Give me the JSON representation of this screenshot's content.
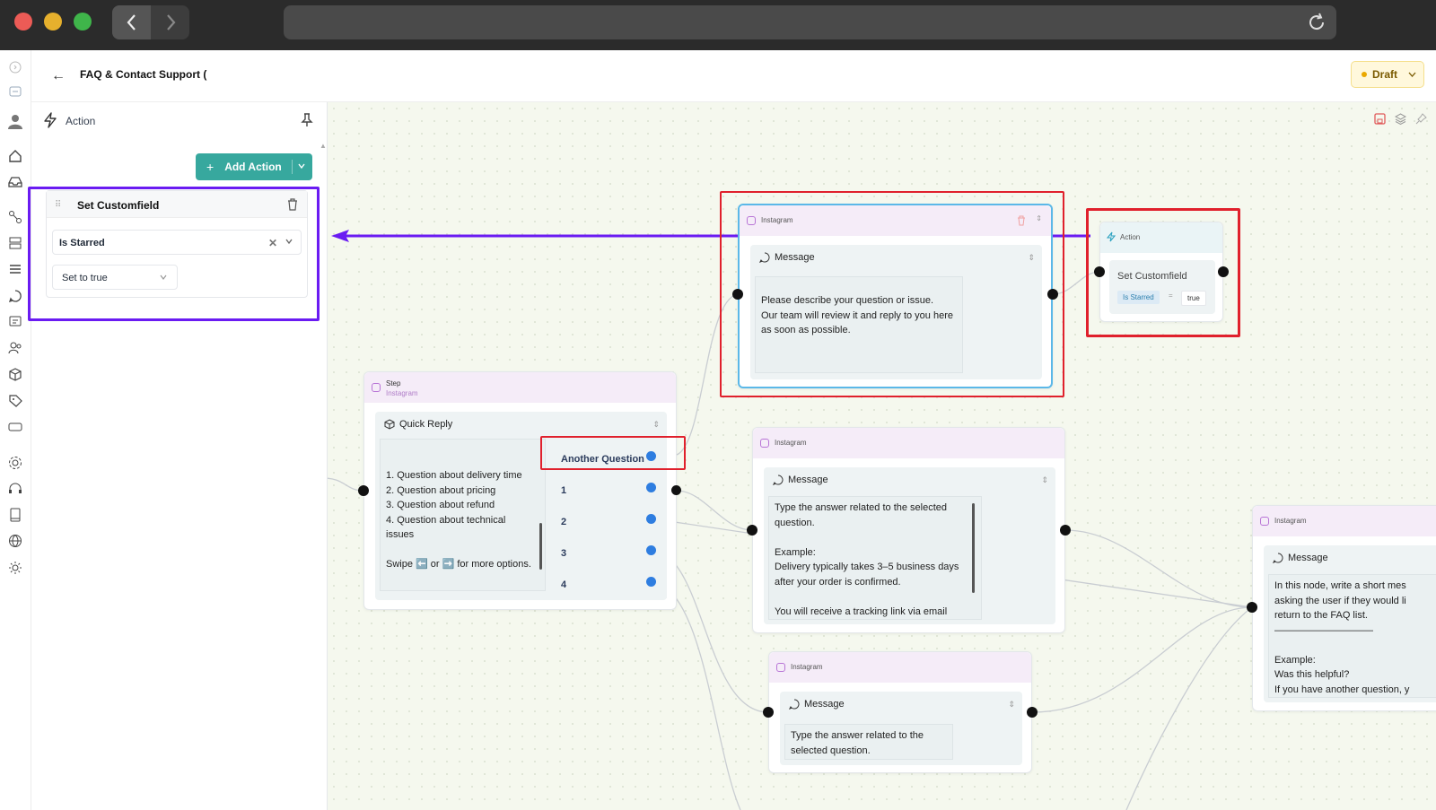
{
  "header": {
    "title": "FAQ & Contact Support (",
    "status": "Draft"
  },
  "sidebar": {
    "title": "Action",
    "add_action_label": "Add Action",
    "action_card": {
      "title": "Set Customfield",
      "field": "Is Starred",
      "value": "Set to true"
    }
  },
  "nodes": {
    "message_top": {
      "platform": "Instagram",
      "type": "Message",
      "text": [
        "Please describe your question or issue.",
        "Our team will review it and reply to you here",
        "as soon as possible."
      ]
    },
    "action_node": {
      "label": "Action",
      "title": "Set Customfield",
      "field_tag": "Is Starred",
      "op": "=",
      "value_tag": "true"
    },
    "step_node": {
      "label": "Step",
      "platform": "Instagram",
      "type": "Quick Reply",
      "text": [
        "1. Question about delivery time",
        "2. Question about pricing",
        "3. Question about refund",
        "4. Question about technical",
        "issues",
        "",
        "Swipe ⬅️ or ➡️ for more options."
      ],
      "buttons": [
        "Another Question",
        "1",
        "2",
        "3",
        "4"
      ]
    },
    "message_mid": {
      "platform": "Instagram",
      "type": "Message",
      "text": [
        "Type the answer related to the selected",
        "question.",
        "",
        "Example:",
        "Delivery typically takes 3–5 business days",
        "after your order is confirmed.",
        "",
        "You will receive a tracking link via email"
      ]
    },
    "message_bottom": {
      "platform": "Instagram",
      "type": "Message",
      "text": [
        "Type the answer related to the",
        "selected question."
      ]
    },
    "message_right": {
      "platform": "Instagram",
      "type": "Message",
      "text": [
        "In this node, write a short mes",
        "asking the user if they would li",
        "return to the FAQ list.",
        "——————————",
        "",
        "Example:",
        "Was this helpful?",
        "If you have another question, y"
      ]
    }
  },
  "colors": {
    "accent": "#37a89e",
    "highlight_purple": "#6a1bf2",
    "highlight_red": "#e0202c",
    "handle_blue": "#2e7de0"
  }
}
